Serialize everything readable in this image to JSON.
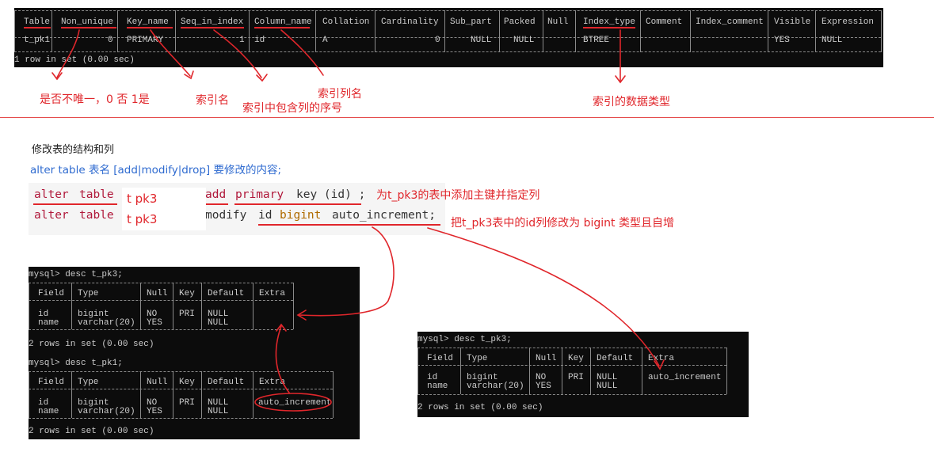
{
  "top_table": {
    "headers": [
      "Table",
      "Non_unique",
      "Key_name",
      "Seq_in_index",
      "Column_name",
      "Collation",
      "Cardinality",
      "Sub_part",
      "Packed",
      "Null",
      "Index_type",
      "Comment",
      "Index_comment",
      "Visible",
      "Expression"
    ],
    "row": [
      "t_pk1",
      "0",
      "PRIMARY",
      "1",
      "id",
      "A",
      "0",
      "NULL",
      "NULL",
      "",
      "BTREE",
      "",
      "",
      "YES",
      "NULL"
    ],
    "footer": "1 row in set (0.00 sec)"
  },
  "annotations": {
    "non_unique": "是否不唯一，0 否 1是",
    "key_name": "索引名",
    "seq": "索引中包含列的序号",
    "column": "索引列名",
    "index_type": "索引的数据类型"
  },
  "section": {
    "title": "修改表的结构和列",
    "syntax": "alter table 表名 [add|modify|drop] 要修改的内容;"
  },
  "code": {
    "line1": {
      "kw1": "alter",
      "kw2": "table",
      "table": "t pk3",
      "add": "add",
      "primary": "primary",
      "rest": "key (id) ;",
      "note": "为t_pk3的表中添加主键并指定列"
    },
    "line2": {
      "kw1": "alter",
      "kw2": "table",
      "table": "t pk3",
      "modify": "modify",
      "col": "id",
      "type": "bigint",
      "rest": "auto_increment;",
      "note": "把t_pk3表中的id列修改为 bigint 类型且自增"
    }
  },
  "term_left": {
    "cmd1": "mysql> desc t_pk3;",
    "cmd2": "mysql> desc t_pk1;",
    "headers": [
      "Field",
      "Type",
      "Null",
      "Key",
      "Default",
      "Extra"
    ],
    "rows_pk3": {
      "field": [
        "id",
        "name"
      ],
      "type": [
        "bigint",
        "varchar(20)"
      ],
      "null": [
        "NO",
        "YES"
      ],
      "key": [
        "PRI",
        ""
      ],
      "default": [
        "NULL",
        "NULL"
      ],
      "extra": [
        "",
        ""
      ]
    },
    "rows_pk1": {
      "field": [
        "id",
        "name"
      ],
      "type": [
        "bigint",
        "varchar(20)"
      ],
      "null": [
        "NO",
        "YES"
      ],
      "key": [
        "PRI",
        ""
      ],
      "default": [
        "NULL",
        "NULL"
      ],
      "extra": [
        "auto_increment",
        ""
      ]
    },
    "footer": "2 rows in set (0.00 sec)"
  },
  "term_right": {
    "cmd": "mysql> desc t_pk3;",
    "headers": [
      "Field",
      "Type",
      "Null",
      "Key",
      "Default",
      "Extra"
    ],
    "rows": {
      "field": [
        "id",
        "name"
      ],
      "type": [
        "bigint",
        "varchar(20)"
      ],
      "null": [
        "NO",
        "YES"
      ],
      "key": [
        "PRI",
        ""
      ],
      "default": [
        "NULL",
        "NULL"
      ],
      "extra": [
        "auto_increment",
        ""
      ]
    },
    "footer": "2 rows in set (0.00 sec)"
  },
  "colors": {
    "annotation_red": "#e0262b",
    "syntax_blue": "#2f6bd0",
    "terminal_bg": "#0c0c0c",
    "terminal_fg": "#cccccc"
  }
}
